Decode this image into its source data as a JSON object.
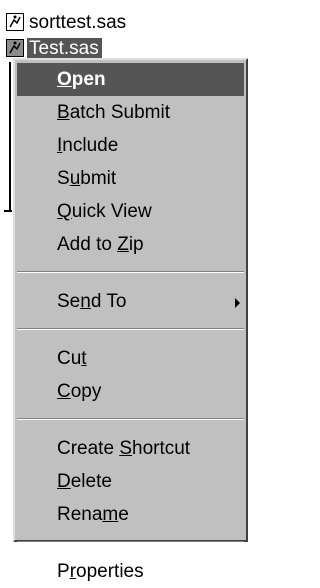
{
  "files": [
    {
      "name": "sorttest.sas",
      "selected": false,
      "icon": "sas-program-icon"
    },
    {
      "name": "Test.sas",
      "selected": true,
      "icon": "sas-program-icon"
    }
  ],
  "menu": {
    "groups": [
      [
        {
          "pre": "",
          "ul": "O",
          "post": "pen",
          "default": true
        },
        {
          "pre": "",
          "ul": "B",
          "post": "atch Submit"
        },
        {
          "pre": "",
          "ul": "I",
          "post": "nclude"
        },
        {
          "pre": "S",
          "ul": "u",
          "post": "bmit"
        },
        {
          "pre": "",
          "ul": "Q",
          "post": "uick View"
        },
        {
          "pre": "Add to ",
          "ul": "Z",
          "post": "ip"
        }
      ],
      [
        {
          "pre": "Se",
          "ul": "n",
          "post": "d To",
          "submenu": true
        }
      ],
      [
        {
          "pre": "Cu",
          "ul": "t",
          "post": ""
        },
        {
          "pre": "",
          "ul": "C",
          "post": "opy"
        }
      ],
      [
        {
          "pre": "Create ",
          "ul": "S",
          "post": "hortcut"
        },
        {
          "pre": "",
          "ul": "D",
          "post": "elete"
        },
        {
          "pre": "Rena",
          "ul": "m",
          "post": "e"
        }
      ],
      [
        {
          "pre": "P",
          "ul": "r",
          "post": "operties"
        }
      ]
    ]
  },
  "colors": {
    "menu_bg": "#c0c0c0",
    "highlight": "#555555",
    "highlight_text": "#ffffff"
  }
}
